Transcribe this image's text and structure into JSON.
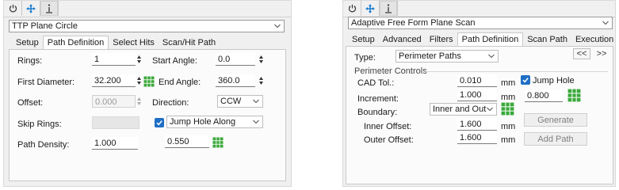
{
  "left": {
    "toolbar": {
      "icons": [
        "power-icon",
        "move-icon",
        "info-bar-icon"
      ]
    },
    "strategy": "TTP Plane Circle",
    "tabs": [
      "Setup",
      "Path Definition",
      "Select Hits",
      "Scan/Hit Path"
    ],
    "active_tab": "Path Definition",
    "fields": {
      "rings_label": "Rings:",
      "rings_value": "1",
      "start_angle_label": "Start Angle:",
      "start_angle_value": "0.0",
      "first_diameter_label": "First Diameter:",
      "first_diameter_value": "32.200",
      "end_angle_label": "End Angle:",
      "end_angle_value": "360.0",
      "offset_label": "Offset:",
      "offset_value": "0.000",
      "direction_label": "Direction:",
      "direction_value": "CCW",
      "skip_rings_label": "Skip Rings:",
      "jump_hole_label": "Jump Hole Along",
      "path_density_label": "Path Density:",
      "path_density_value": "1.000",
      "jump_hole_value": "0.550"
    }
  },
  "right": {
    "toolbar": {
      "icons": [
        "power-icon",
        "move-icon",
        "info-bar-icon"
      ]
    },
    "strategy": "Adaptive Free Form Plane Scan",
    "tabs": [
      "Setup",
      "Advanced",
      "Filters",
      "Path Definition",
      "Scan Path",
      "Execution"
    ],
    "active_tab": "Path Definition",
    "type_label": "Type:",
    "type_value": "Perimeter Paths",
    "prev_button": "<<",
    "next_button": ">>",
    "group_title": "Perimeter Controls",
    "fields": {
      "cad_tol_label": "CAD Tol.:",
      "cad_tol_value": "0.010",
      "increment_label": "Increment:",
      "increment_value": "1.000",
      "boundary_label": "Boundary:",
      "boundary_value": "Inner and Out",
      "inner_offset_label": "Inner Offset:",
      "inner_offset_value": "1.600",
      "outer_offset_label": "Outer Offset:",
      "outer_offset_value": "1.600",
      "unit": "mm",
      "jump_hole_label": "Jump Hole",
      "jump_hole_value": "0.800"
    },
    "generate_button": "Generate",
    "add_path_button": "Add Path"
  },
  "colors": {
    "accent": "#1f6fc5",
    "grid_green": "#3aa83a"
  }
}
